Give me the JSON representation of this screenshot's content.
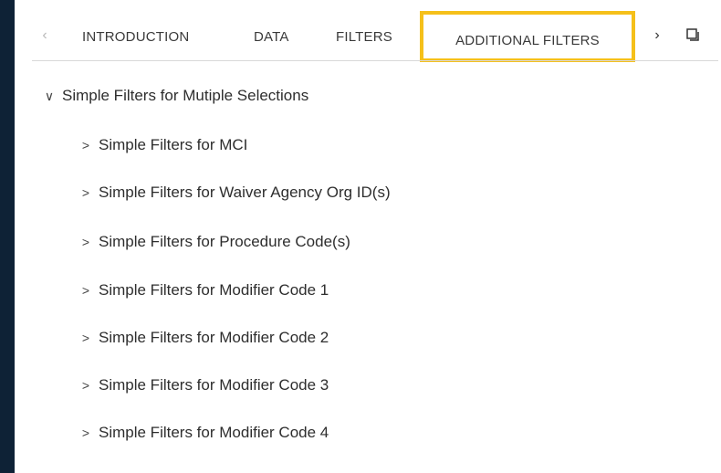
{
  "tabs": {
    "prev_icon": "chevron-left-icon",
    "next_icon": "chevron-right-icon",
    "window_icon": "window-icon",
    "items": [
      {
        "label": "INTRODUCTION"
      },
      {
        "label": "DATA"
      },
      {
        "label": "FILTERS"
      },
      {
        "label": "ADDITIONAL FILTERS",
        "highlighted": true
      }
    ],
    "highlight_color": "#f5c01a"
  },
  "tree": {
    "root": {
      "label": "Simple Filters for Mutiple Selections",
      "expanded": true
    },
    "children": [
      {
        "label": "Simple Filters for MCI"
      },
      {
        "label": "Simple Filters for Waiver Agency Org ID(s)"
      },
      {
        "label": "Simple Filters for Procedure Code(s)"
      },
      {
        "label": "Simple Filters for Modifier Code 1"
      },
      {
        "label": "Simple Filters for Modifier Code 2"
      },
      {
        "label": "Simple Filters for Modifier Code 3"
      },
      {
        "label": "Simple Filters for Modifier Code 4"
      }
    ]
  },
  "colors": {
    "background": "#0e2236",
    "panel": "#ffffff",
    "text": "#2e2e2e"
  }
}
